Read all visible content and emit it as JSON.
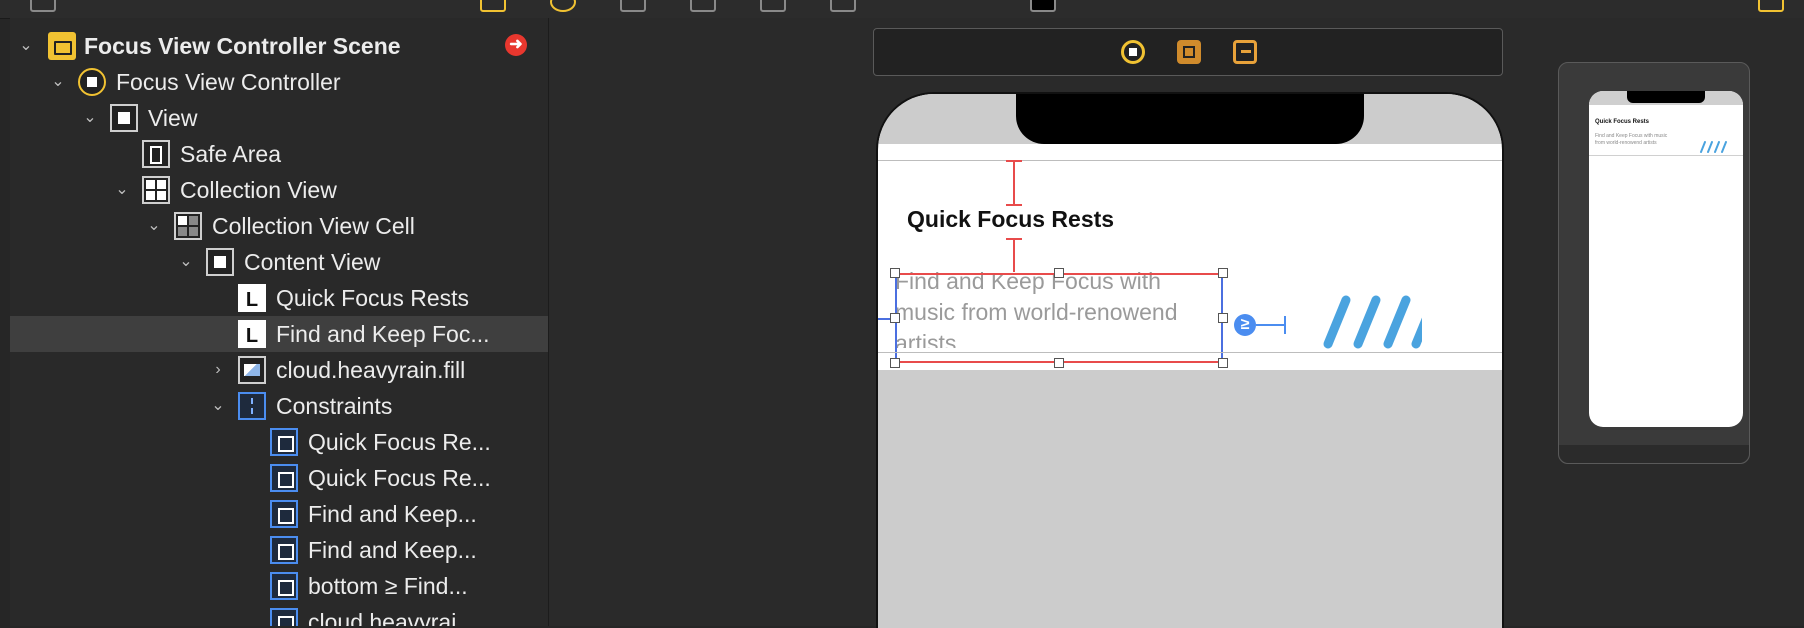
{
  "outline": {
    "items": [
      {
        "label": "Focus View Controller Scene",
        "icon": "scene-icon",
        "level": 0,
        "expanded": true
      },
      {
        "label": "Focus View Controller",
        "icon": "view-controller-icon",
        "level": 1,
        "expanded": true
      },
      {
        "label": "View",
        "icon": "view-icon",
        "level": 2,
        "expanded": true
      },
      {
        "label": "Safe Area",
        "icon": "safe-area-icon",
        "level": 3
      },
      {
        "label": "Collection View",
        "icon": "collection-view-icon",
        "level": 3,
        "expanded": true
      },
      {
        "label": "Collection View Cell",
        "icon": "collection-view-cell-icon",
        "level": 4,
        "expanded": true
      },
      {
        "label": "Content View",
        "icon": "content-view-icon",
        "level": 5,
        "expanded": true
      },
      {
        "label": "Quick Focus Rests",
        "icon": "label-icon",
        "level": 6
      },
      {
        "label": "Find and Keep Foc...",
        "icon": "label-icon",
        "level": 6,
        "selected": true
      },
      {
        "label": "cloud.heavyrain.fill",
        "icon": "image-view-icon",
        "level": 6,
        "expanded": false
      },
      {
        "label": "Constraints",
        "icon": "constraints-icon",
        "level": 6,
        "expanded": true
      },
      {
        "label": "Quick Focus Re...",
        "icon": "constraint-leading-icon",
        "level": 7
      },
      {
        "label": "Quick Focus Re...",
        "icon": "constraint-vertical-icon",
        "level": 7
      },
      {
        "label": "Find and Keep...",
        "icon": "constraint-top-icon",
        "level": 7
      },
      {
        "label": "Find and Keep...",
        "icon": "constraint-leading-icon",
        "level": 7
      },
      {
        "label": "bottom ≥ Find...",
        "icon": "constraint-bottom-icon",
        "level": 7
      },
      {
        "label": "cloud.heavyrai...",
        "icon": "constraint-icon",
        "level": 7
      }
    ]
  },
  "canvas": {
    "cell_title": "Quick Focus Rests",
    "cell_subtitle": "Find and Keep Focus with music from world-renowend artists",
    "constraint_badge": "≥",
    "mini_title": "Quick Focus Rests",
    "mini_subtitle": "Find and Keep Focus with music from world-renowend artists"
  },
  "colors": {
    "accent_yellow": "#f1c232",
    "constraint_blue": "#4b8df0",
    "constraint_red": "#e84b4b",
    "rain_blue": "#4aa3df",
    "selection_bg": "#3f3f3f"
  }
}
